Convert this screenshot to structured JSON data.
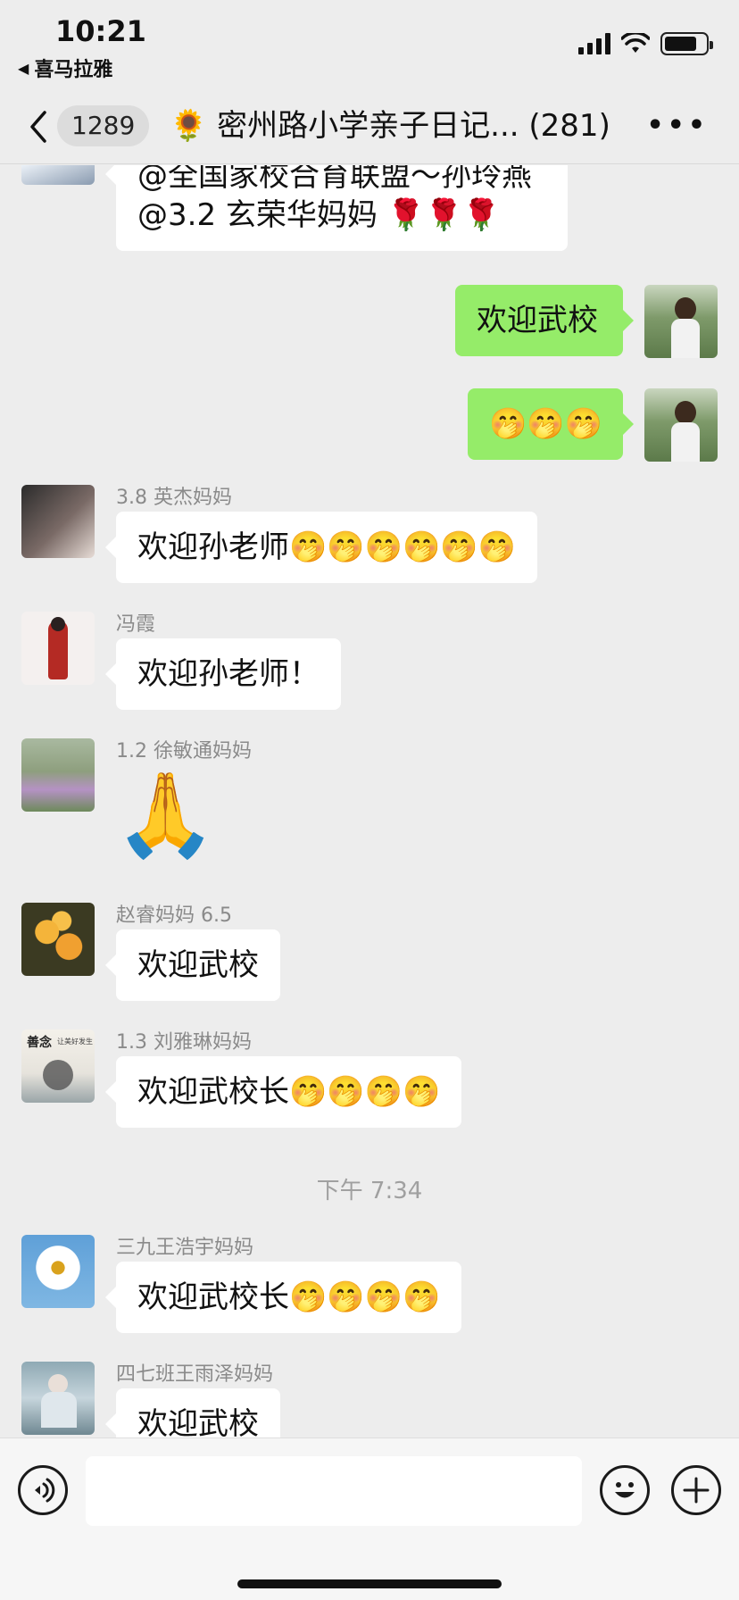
{
  "status_bar": {
    "time": "10:21",
    "back_app": "喜马拉雅"
  },
  "nav": {
    "unread_count": "1289",
    "title_emoji": "🌻",
    "title": "密州路小学亲子日记...",
    "member_count": "(281)"
  },
  "messages": [
    {
      "side": "in",
      "sender": "",
      "lines": [
        "@全国家校合育联盟～孙玲燕",
        "@3.2 玄荣华妈妈 🌹🌹🌹"
      ]
    },
    {
      "side": "out",
      "text": "欢迎武校"
    },
    {
      "side": "out",
      "text": "🤭🤭🤭"
    },
    {
      "side": "in",
      "sender": "3.8 英杰妈妈",
      "text": "欢迎孙老师🤭🤭🤭🤭🤭🤭"
    },
    {
      "side": "in",
      "sender": "冯霞",
      "text": "欢迎孙老师！"
    },
    {
      "side": "in",
      "sender": "1.2 徐敏通妈妈",
      "sticker": "🙏"
    },
    {
      "side": "in",
      "sender": "赵睿妈妈 6.5",
      "text": "欢迎武校"
    },
    {
      "side": "in",
      "sender": "1.3 刘雅琳妈妈",
      "text": "欢迎武校长🤭🤭🤭🤭"
    },
    {
      "side": "in",
      "sender": "三九王浩宇妈妈",
      "text": "欢迎武校长🤭🤭🤭🤭"
    },
    {
      "side": "in",
      "sender": "四七班王雨泽妈妈",
      "text": "欢迎武校"
    }
  ],
  "timestamp": "下午 7:34",
  "avatar_labels": {
    "liu_yalin": "善念",
    "liu_yalin_sub": "让美好发生"
  },
  "colors": {
    "out_bubble": "#95ec69",
    "in_bubble": "#ffffff",
    "background": "#ededed"
  },
  "icons": [
    "chevron-left-icon",
    "more-icon",
    "voice-icon",
    "emoji-icon",
    "plus-icon",
    "signal-icon",
    "wifi-icon",
    "battery-icon"
  ]
}
